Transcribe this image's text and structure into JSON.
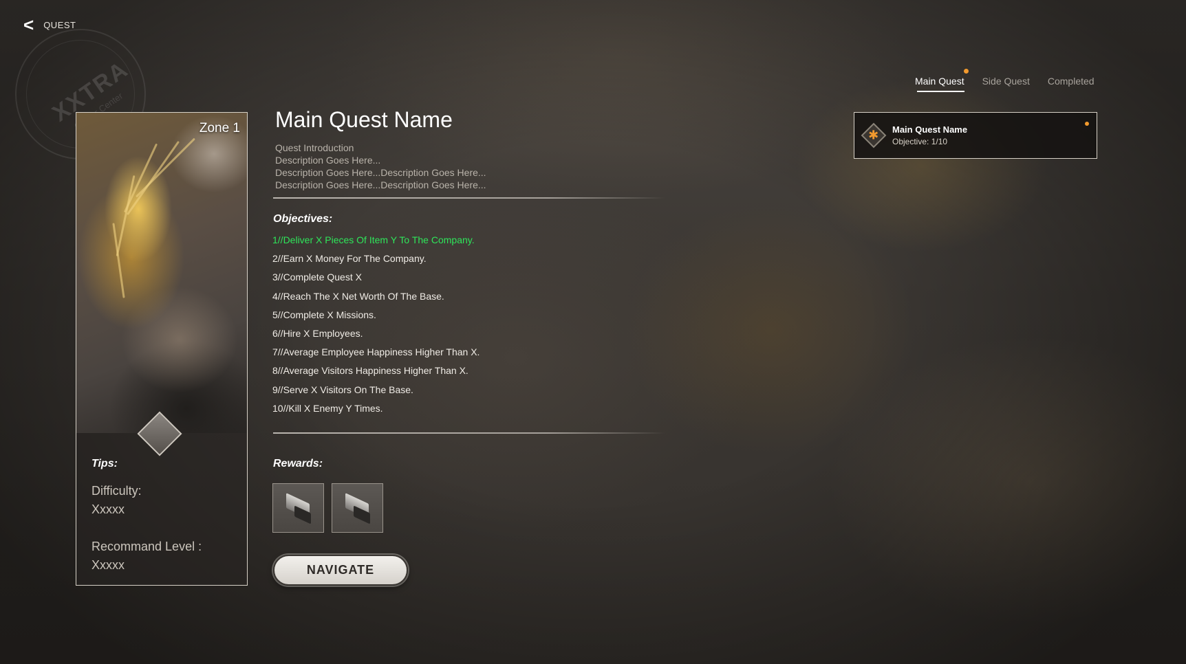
{
  "header": {
    "back_label": "QUEST",
    "back_icon": "chevron-left-icon"
  },
  "watermark": {
    "text": "XXTRA",
    "subtext": "Career Center"
  },
  "tabs": [
    {
      "label": "Main Quest",
      "active": true,
      "has_notification": true
    },
    {
      "label": "Side Quest",
      "active": false,
      "has_notification": false
    },
    {
      "label": "Completed",
      "active": false,
      "has_notification": false
    }
  ],
  "quest_list": [
    {
      "title": "Main Quest Name",
      "objective": "Objective: 1/10",
      "icon": "asterisk-diamond-icon",
      "has_notification": true,
      "selected": true
    }
  ],
  "zone": {
    "label": "Zone 1",
    "tips_title": "Tips:",
    "difficulty_label": "Difficulty:",
    "difficulty_value": "Xxxxx",
    "level_label": "Recommand Level :",
    "level_value": "Xxxxx"
  },
  "quest": {
    "title": "Main Quest Name",
    "intro": [
      "Quest Introduction",
      "Description Goes Here...",
      "Description Goes Here...Description Goes Here...",
      "Description Goes Here...Description Goes Here..."
    ],
    "objectives_title": "Objectives:",
    "objectives": [
      {
        "text": "1//Deliver X Pieces Of Item Y To The Company.",
        "done": true
      },
      {
        "text": "2//Earn X Money For The Company.",
        "done": false
      },
      {
        "text": "3//Complete Quest X",
        "done": false
      },
      {
        "text": "4//Reach The X Net Worth Of The Base.",
        "done": false
      },
      {
        "text": "5//Complete X Missions.",
        "done": false
      },
      {
        "text": "6//Hire X Employees.",
        "done": false
      },
      {
        "text": "7//Average Employee Happiness Higher Than X.",
        "done": false
      },
      {
        "text": "8//Average Visitors Happiness Higher Than X.",
        "done": false
      },
      {
        "text": "9//Serve X Visitors On The Base.",
        "done": false
      },
      {
        "text": "10//Kill X Enemy Y Times.",
        "done": false
      }
    ],
    "rewards_title": "Rewards:",
    "rewards": [
      {
        "icon": "metal-bar-icon"
      },
      {
        "icon": "metal-bar-icon"
      }
    ],
    "navigate_label": "NAVIGATE"
  },
  "colors": {
    "accent": "#f29a2e",
    "completed_objective": "#2ee65a"
  }
}
